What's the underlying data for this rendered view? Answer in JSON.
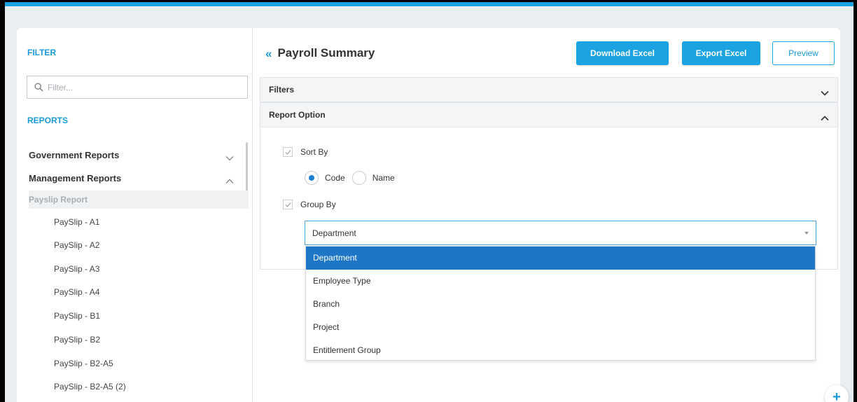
{
  "sidebar": {
    "filter_heading": "FILTER",
    "filter_placeholder": "Filter...",
    "reports_heading": "REPORTS",
    "groups": [
      {
        "label": "Government Reports",
        "state": "collapsed"
      },
      {
        "label": "Management Reports",
        "state": "expanded"
      }
    ],
    "subgroup": "Payslip Report",
    "items": [
      "PaySlip - A1",
      "PaySlip - A2",
      "PaySlip - A3",
      "PaySlip - A4",
      "PaySlip - B1",
      "PaySlip - B2",
      "PaySlip - B2-A5",
      "PaySlip - B2-A5 (2)"
    ]
  },
  "main": {
    "title": "Payroll Summary",
    "buttons": {
      "download": "Download Excel",
      "export": "Export Excel",
      "preview": "Preview"
    },
    "panels": {
      "filters": "Filters",
      "report_option": "Report Option"
    },
    "sort_by": {
      "label": "Sort By",
      "checked": true,
      "options": [
        "Code",
        "Name"
      ],
      "selected": "Code"
    },
    "group_by": {
      "label": "Group By",
      "checked": true,
      "selected": "Department"
    },
    "dropdown_options": [
      "Department",
      "Employee Type",
      "Branch",
      "Project",
      "Entitlement Group"
    ]
  },
  "colors": {
    "accent": "#1aa3e0",
    "selected_option": "#1e76c6"
  },
  "icons": {
    "search": "search-icon",
    "back": "double-chevron-left-icon",
    "fab": "plus-icon"
  }
}
